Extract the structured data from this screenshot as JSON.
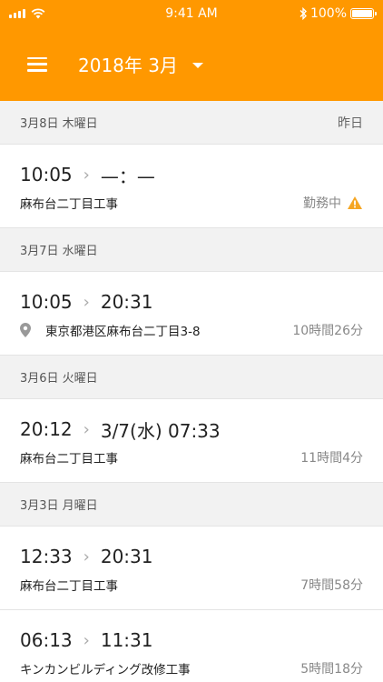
{
  "status_bar": {
    "time": "9:41 AM",
    "battery": "100%"
  },
  "header": {
    "month_label": "2018年 3月"
  },
  "days": [
    {
      "date": "3月8日 木曜日",
      "relative": "昨日",
      "entries": [
        {
          "start": "10:05",
          "end": "—：—",
          "place": "麻布台二丁目工事",
          "duration": "勤務中",
          "warning": true
        }
      ]
    },
    {
      "date": "3月7日 水曜日",
      "entries": [
        {
          "start": "10:05",
          "end": "20:31",
          "place": "東京都港区麻布台二丁目3-8",
          "duration": "10時間26分",
          "location_icon": true
        }
      ]
    },
    {
      "date": "3月6日 火曜日",
      "entries": [
        {
          "start": "20:12",
          "end": "3/7(水) 07:33",
          "place": "麻布台二丁目工事",
          "duration": "11時間4分"
        }
      ]
    },
    {
      "date": "3月3日 月曜日",
      "entries": [
        {
          "start": "12:33",
          "end": "20:31",
          "place": "麻布台二丁目工事",
          "duration": "7時間58分"
        },
        {
          "start": "06:13",
          "end": "11:31",
          "place": "キンカンビルディング改修工事",
          "duration": "5時間18分"
        }
      ]
    }
  ]
}
